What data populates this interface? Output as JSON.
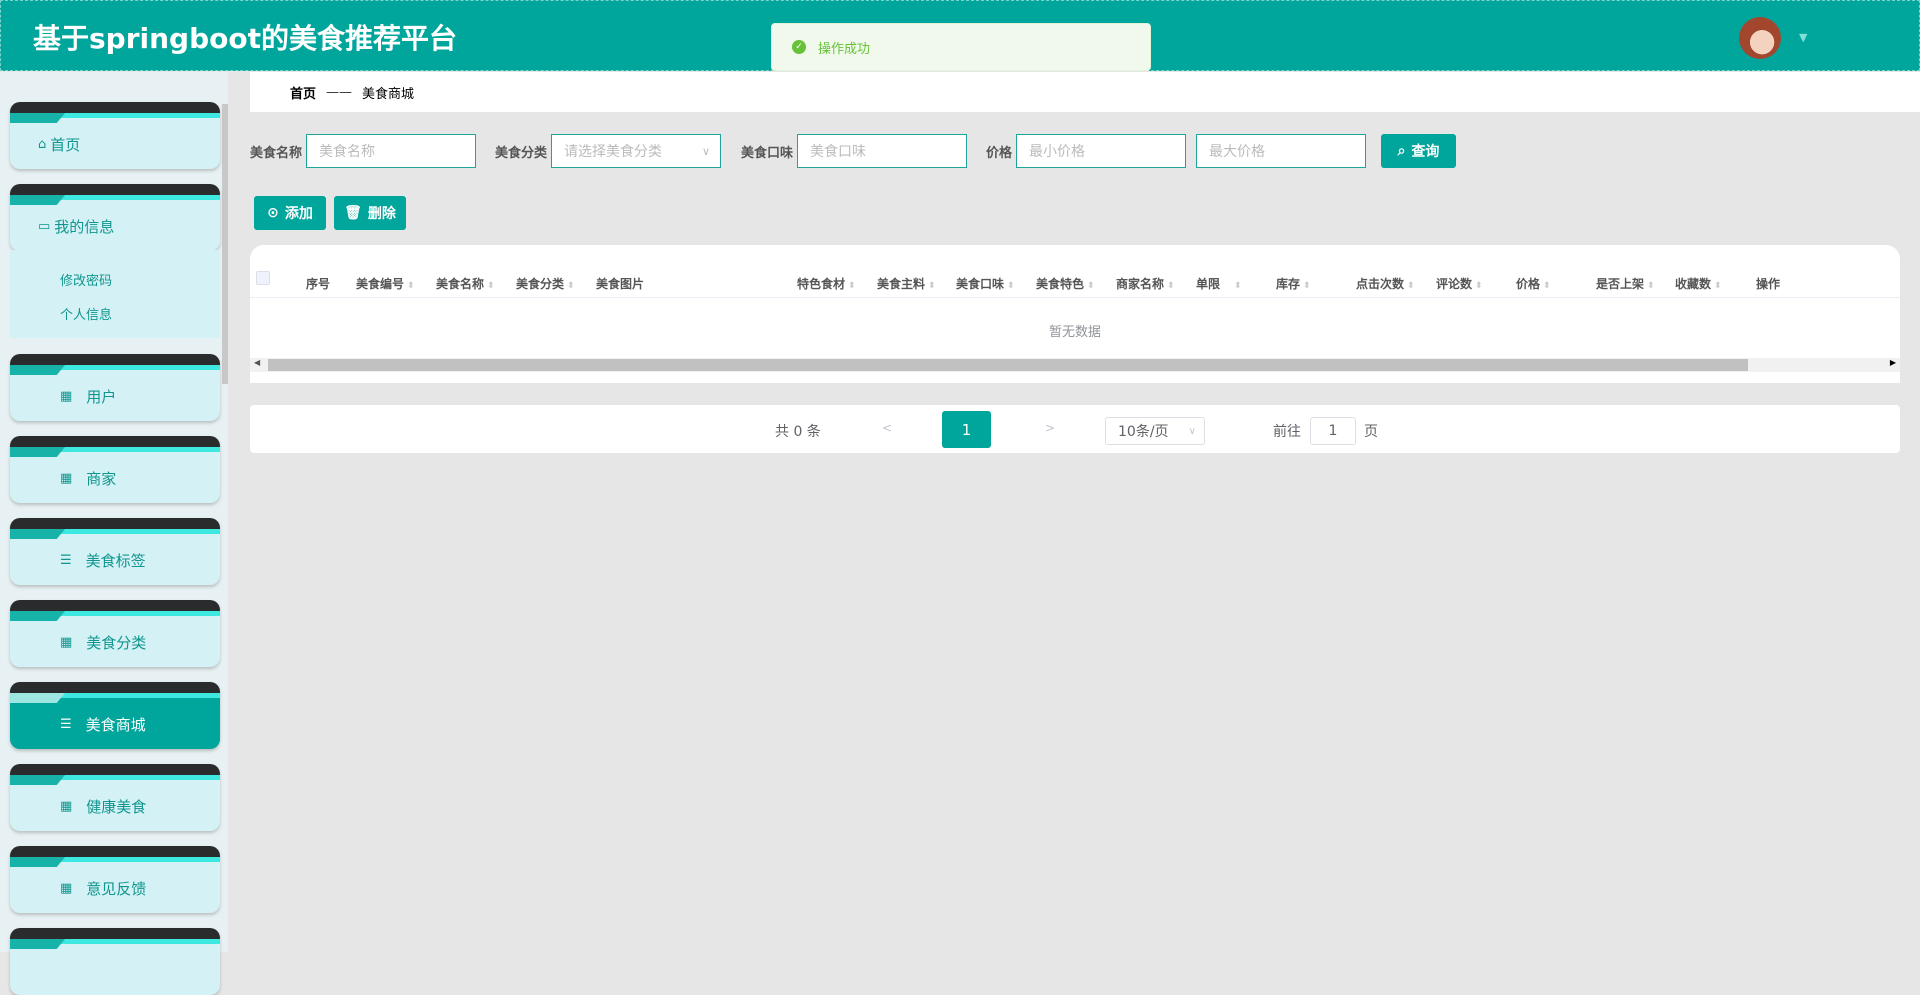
{
  "header": {
    "title": "基于springboot的美食推荐平台",
    "toast": "操作成功"
  },
  "sidebar": {
    "home": "首页",
    "my_info": "我的信息",
    "sub": [
      "修改密码",
      "个人信息"
    ],
    "items": [
      {
        "label": "用户",
        "icon": "grid-icon"
      },
      {
        "label": "商家",
        "icon": "grid-icon"
      },
      {
        "label": "美食标签",
        "icon": "list-icon"
      },
      {
        "label": "美食分类",
        "icon": "grid-icon"
      },
      {
        "label": "美食商城",
        "icon": "list-icon",
        "active": true
      },
      {
        "label": "健康美食",
        "icon": "grid-icon"
      },
      {
        "label": "意见反馈",
        "icon": "grid-icon"
      }
    ]
  },
  "breadcrumb": {
    "home": "首页",
    "sep": "——",
    "current": "美食商城"
  },
  "filters": {
    "name_label": "美食名称",
    "name_ph": "美食名称",
    "cat_label": "美食分类",
    "cat_ph": "请选择美食分类",
    "taste_label": "美食口味",
    "taste_ph": "美食口味",
    "price_label": "价格",
    "min_ph": "最小价格",
    "max_ph": "最大价格",
    "search": "查询"
  },
  "actions": {
    "add": "添加",
    "delete": "删除"
  },
  "table": {
    "columns": [
      "序号",
      "美食编号",
      "美食名称",
      "美食分类",
      "美食图片",
      "特色食材",
      "美食主料",
      "美食口味",
      "美食特色",
      "商家名称",
      "单限",
      "库存",
      "点击次数",
      "评论数",
      "价格",
      "是否上架",
      "收藏数",
      "操作"
    ],
    "empty": "暂无数据"
  },
  "pagination": {
    "total": "共 0 条",
    "prev": "<",
    "current": "1",
    "next": ">",
    "size": "10条/页",
    "goto": "前往",
    "page": "1",
    "unit": "页"
  },
  "colors": {
    "primary": "#00a59b",
    "success": "#67c23a"
  }
}
